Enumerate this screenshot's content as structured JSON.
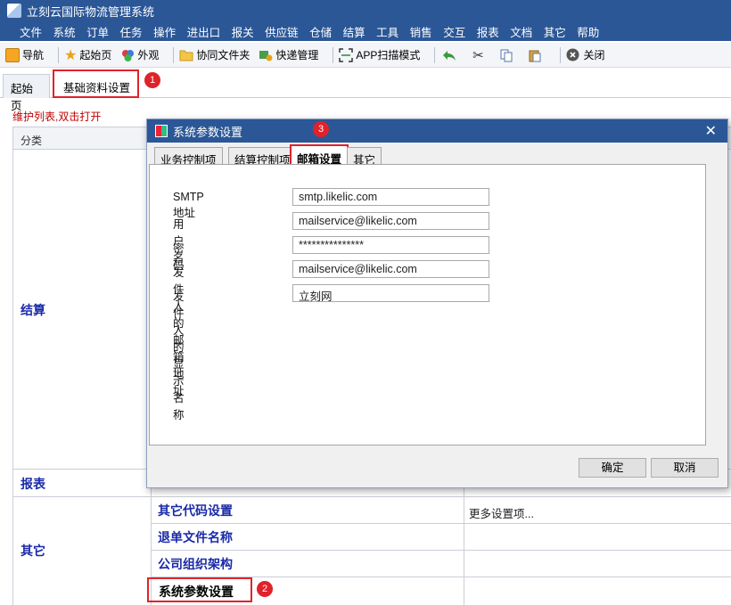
{
  "app": {
    "title": "立刻云国际物流管理系统"
  },
  "menu": [
    "文件",
    "系统",
    "订单",
    "任务",
    "操作",
    "进出口",
    "报关",
    "供应链",
    "仓储",
    "结算",
    "工具",
    "销售",
    "交互",
    "报表",
    "文档",
    "其它",
    "帮助"
  ],
  "toolbar": {
    "nav": "导航",
    "home": "起始页",
    "appearance": "外观",
    "shared_folder": "协同文件夹",
    "express": "快递管理",
    "app_scan": "APP扫描模式",
    "close": "关闭"
  },
  "tabs": {
    "home": "起始页",
    "basic_settings": "基础资料设置"
  },
  "hint": "维护列表,双击打开",
  "grid": {
    "header": "分类",
    "categories": {
      "settlement": "结算",
      "report": "报表",
      "other": "其它"
    },
    "items": [
      "其它代码设置",
      "退单文件名称",
      "公司组织架构",
      "系统参数设置"
    ],
    "more_settings": "更多设置项..."
  },
  "badges": [
    "1",
    "2",
    "3"
  ],
  "dialog": {
    "title": "系统参数设置",
    "tabs": [
      "业务控制项",
      "结算控制项",
      "邮箱设置",
      "其它"
    ],
    "fields": [
      {
        "label": "SMTP地址",
        "value": "smtp.likelic.com"
      },
      {
        "label": "用户名",
        "value": "mailservice@likelic.com"
      },
      {
        "label": "密码",
        "value": "***************"
      },
      {
        "label": "发件人的邮箱地址",
        "value": "mailservice@likelic.com"
      },
      {
        "label": "发件人的显示名称",
        "value": "立刻网"
      }
    ],
    "ok": "确定",
    "cancel": "取消"
  },
  "colors": {
    "titlebar": "#2b5797",
    "highlight": "#e0222a",
    "link_text": "#1a2aa8",
    "hint": "#c00000"
  }
}
